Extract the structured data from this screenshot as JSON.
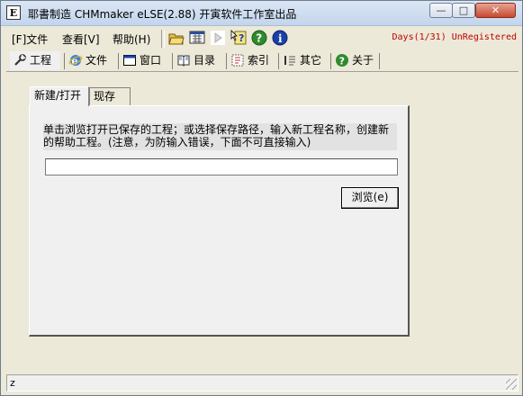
{
  "window": {
    "icon_letter": "E",
    "title": "耶書制造 CHMmaker eLSE(2.88) 开寅软件工作室出品",
    "minimize_glyph": "—",
    "maximize_glyph": "□",
    "close_glyph": "✕"
  },
  "menu": {
    "items": [
      {
        "label": "[F]文件"
      },
      {
        "label": "查看[V]"
      },
      {
        "label": "帮助(H)"
      }
    ],
    "toolbar_icons": [
      "open-folder-icon",
      "save-grid-icon",
      "play-icon",
      "help-cursor-icon",
      "help-icon",
      "info-icon"
    ],
    "registration_status": "Days(1/31) UnRegistered"
  },
  "main_tabs": [
    {
      "label": "工程",
      "icon": "wrench-icon"
    },
    {
      "label": "文件",
      "icon": "ie-globe-icon"
    },
    {
      "label": "窗口",
      "icon": "window-icon"
    },
    {
      "label": "目录",
      "icon": "book-icon"
    },
    {
      "label": "索引",
      "icon": "index-icon"
    },
    {
      "label": "其它",
      "icon": "list-icon"
    },
    {
      "label": "关于",
      "icon": "help-icon"
    }
  ],
  "project": {
    "subtabs": [
      {
        "label": "新建/打开"
      },
      {
        "label": "现存"
      }
    ],
    "description": "单击浏览打开已保存的工程；或选择保存路径，输入新工程名称，创建新的帮助工程。(注意，为防输入错误，下面不可直接输入)",
    "path_value": "",
    "browse_label": "浏览(e)"
  },
  "status": {
    "text": "z"
  },
  "colors": {
    "registration": "#c00000",
    "help_green": "#2e8b2e",
    "info_blue": "#1a3fa8"
  }
}
